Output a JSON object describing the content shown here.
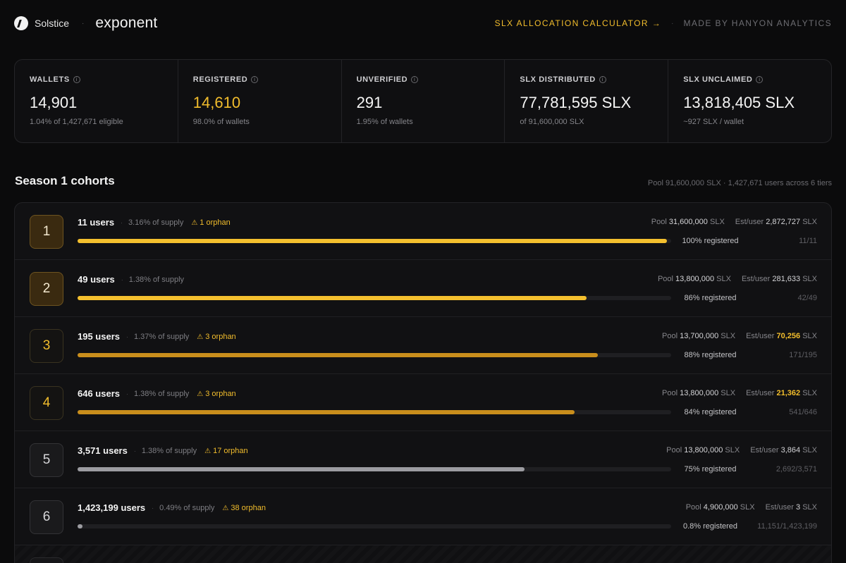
{
  "header": {
    "brand_name": "Solstice",
    "brand_icon": "solstice-logo-icon",
    "product_name": "exponent",
    "calculator_link": "SLX ALLOCATION CALCULATOR →",
    "made_by": "MADE BY HANYON ANALYTICS"
  },
  "stats": [
    {
      "label": "WALLETS",
      "value": "14,901",
      "sub": "1.04% of 1,427,671 eligible",
      "accent": false
    },
    {
      "label": "REGISTERED",
      "value": "14,610",
      "sub": "98.0% of wallets",
      "accent": true
    },
    {
      "label": "UNVERIFIED",
      "value": "291",
      "sub": "1.95% of wallets",
      "accent": false
    },
    {
      "label": "SLX DISTRIBUTED",
      "value": "77,781,595 SLX",
      "sub": "of 91,600,000 SLX",
      "accent": false
    },
    {
      "label": "SLX UNCLAIMED",
      "value": "13,818,405 SLX",
      "sub": "~927 SLX / wallet",
      "accent": false
    }
  ],
  "section": {
    "title": "Season 1 cohorts",
    "meta": "Pool 91,600,000 SLX · 1,427,671 users across 6 tiers"
  },
  "labels": {
    "pool": "Pool",
    "slx": "SLX",
    "est_user": "Est/user",
    "registered_suffix": "registered",
    "orphan_suffix": "orphan",
    "orphan_icon": "warning-icon",
    "info_icon": "i"
  },
  "colors": {
    "accent": "#f2bd2c",
    "bar_gold": "#f4c02e",
    "bar_amber": "#c98e1c",
    "bar_gray": "#9c9ca1"
  },
  "cohorts": [
    {
      "tier": "1",
      "users": "11 users",
      "supply": "3.16% of supply",
      "orphan": "1 orphan",
      "pool": "31,600,000",
      "est": "2,872,727",
      "est_highlight": false,
      "registered": "100% registered",
      "fraction": "11/11",
      "fill": 0.993,
      "bar": "gold",
      "tier_style": "gold-solid"
    },
    {
      "tier": "2",
      "users": "49 users",
      "supply": "1.38% of supply",
      "orphan": "",
      "pool": "13,800,000",
      "est": "281,633",
      "est_highlight": false,
      "registered": "86% registered",
      "fraction": "42/49",
      "fill": 0.857,
      "bar": "gold",
      "tier_style": "gold-solid"
    },
    {
      "tier": "3",
      "users": "195 users",
      "supply": "1.37% of supply",
      "orphan": "3 orphan",
      "pool": "13,700,000",
      "est": "70,256",
      "est_highlight": true,
      "registered": "88% registered",
      "fraction": "171/195",
      "fill": 0.877,
      "bar": "amber",
      "tier_style": "gold-outline"
    },
    {
      "tier": "4",
      "users": "646 users",
      "supply": "1.38% of supply",
      "orphan": "3 orphan",
      "pool": "13,800,000",
      "est": "21,362",
      "est_highlight": true,
      "registered": "84% registered",
      "fraction": "541/646",
      "fill": 0.837,
      "bar": "amber",
      "tier_style": "gold-outline"
    },
    {
      "tier": "5",
      "users": "3,571 users",
      "supply": "1.38% of supply",
      "orphan": "17 orphan",
      "pool": "13,800,000",
      "est": "3,864",
      "est_highlight": false,
      "registered": "75% registered",
      "fraction": "2,692/3,571",
      "fill": 0.753,
      "bar": "gray",
      "tier_style": "gray"
    },
    {
      "tier": "6",
      "users": "1,423,199 users",
      "supply": "0.49% of supply",
      "orphan": "38 orphan",
      "pool": "4,900,000",
      "est": "3",
      "est_highlight": false,
      "registered": "0.8% registered",
      "fraction": "11,151/1,423,199",
      "fill": 0.008,
      "bar": "gray",
      "tier_style": "gray"
    }
  ]
}
